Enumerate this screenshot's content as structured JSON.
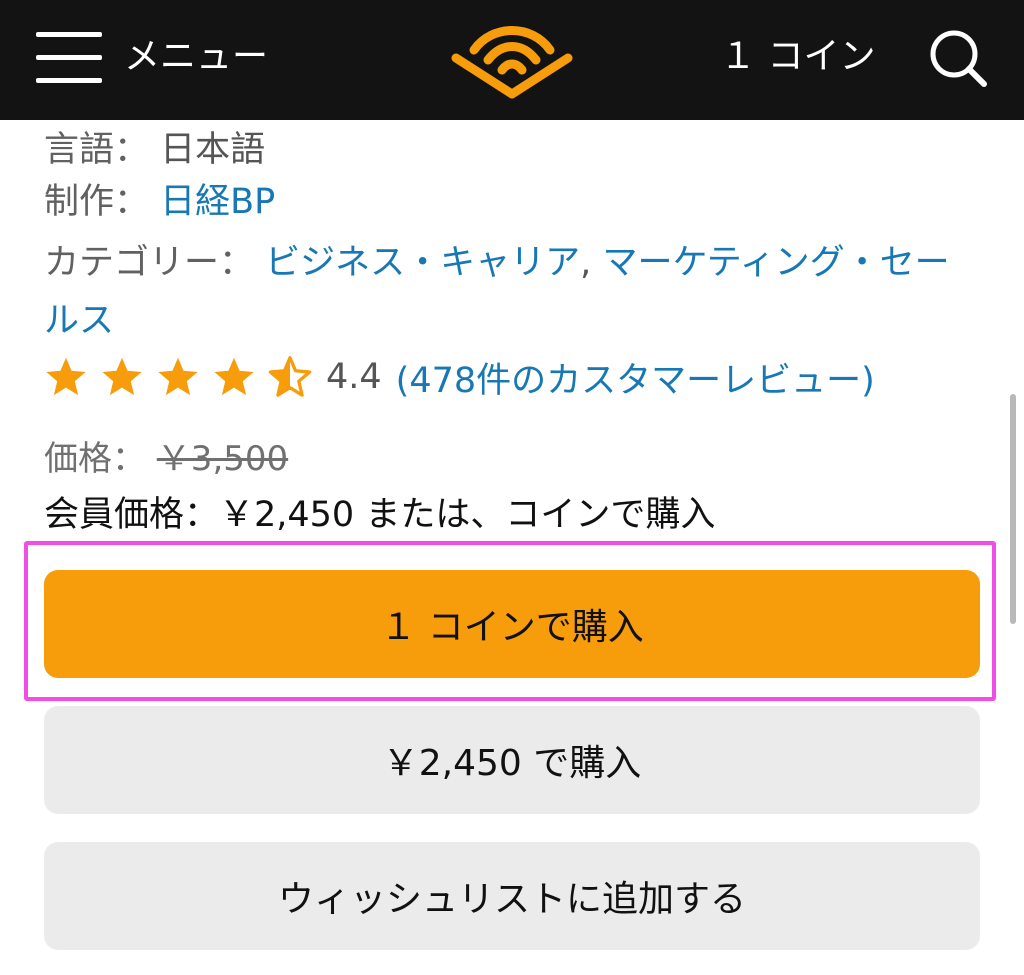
{
  "header": {
    "menu_label": "メニュー",
    "coins": "１ コイン",
    "icons": [
      "hamburger-menu-icon",
      "audible-logo",
      "search-icon"
    ],
    "colors": {
      "background": "#131313",
      "logo": "#f79c0a"
    }
  },
  "details": {
    "language_label": "言語：",
    "language_value": "日本語",
    "publisher_label": "制作：",
    "publisher_value": "日経BP",
    "category_label": "カテゴリー：",
    "category_1": "ビジネス・キャリア",
    "category_sep": ", ",
    "category_2": "マーケティング・セールス"
  },
  "rating": {
    "value": "4.4",
    "stars": 4.5,
    "reviews_link": "(478件のカスタマーレビュー)",
    "star_color": "#f79c0a"
  },
  "pricing": {
    "price_label": "価格：",
    "list_price": "￥3,500",
    "member_text": "会員価格：￥2,450 または、コインで購入"
  },
  "buttons": {
    "buy_with_coin": "１ コインで購入",
    "buy_with_price": "￥2,450 で購入",
    "add_to_wishlist": "ウィッシュリストに追加する"
  },
  "colors": {
    "link": "#1778b5",
    "primary_button": "#f79c0a",
    "secondary_button": "#ebebeb",
    "highlight": "#f04ee6"
  }
}
